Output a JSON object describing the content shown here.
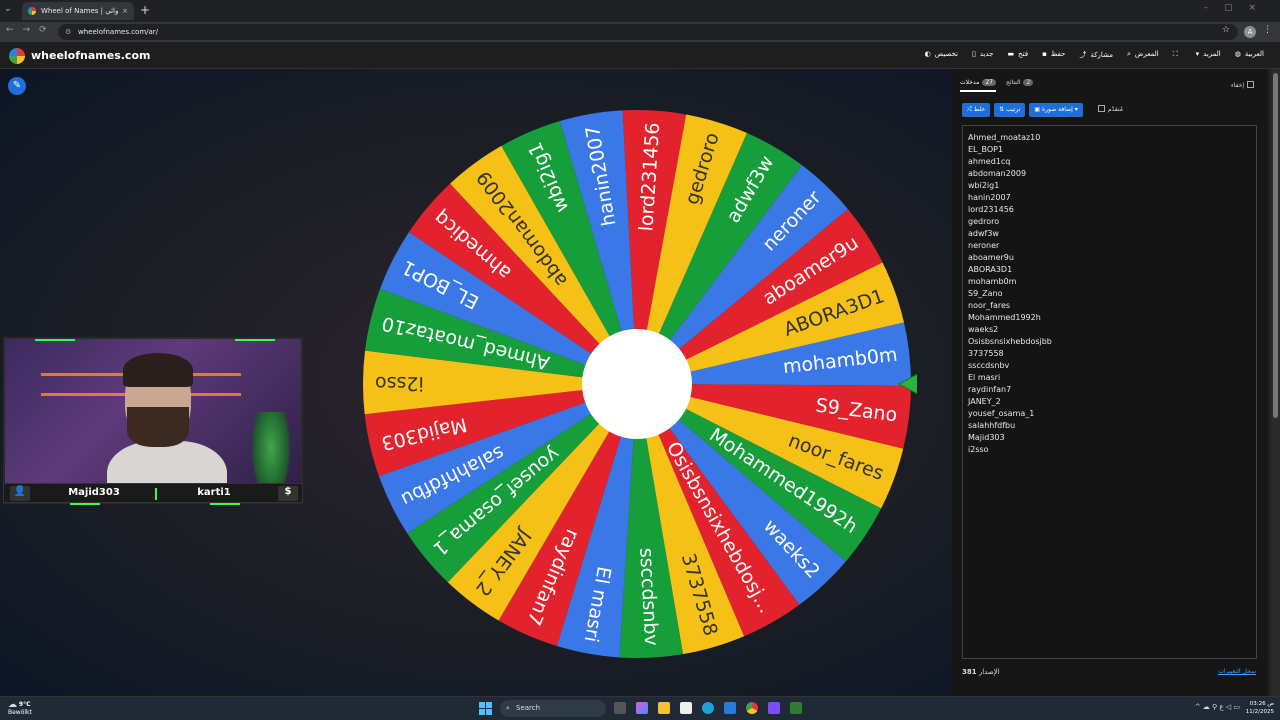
{
  "browser": {
    "tab_title": "Wheel of Names | سم العشوائي",
    "tab_close": "×",
    "tab_menu": "⌄",
    "new_tab": "+",
    "window_controls": "–▢×",
    "nav": "←→⟳",
    "url": "wheelofnames.com/ar/",
    "profile_initial": "A"
  },
  "header": {
    "site_name": "wheelofnames.com",
    "menu": [
      {
        "label": "العربية",
        "icon": "globe-icon"
      },
      {
        "label": "المزيد",
        "icon": "chevron-down-icon"
      },
      {
        "label": "",
        "icon": "fullscreen-icon"
      },
      {
        "label": "المعرض",
        "icon": "search-icon"
      },
      {
        "label": "مشاركة",
        "icon": "share-icon"
      },
      {
        "label": "حفظ",
        "icon": "save-icon"
      },
      {
        "label": "فتح",
        "icon": "folder-icon"
      },
      {
        "label": "جديد",
        "icon": "new-file-icon"
      },
      {
        "label": "تخصيص",
        "icon": "palette-icon"
      }
    ]
  },
  "wheel": {
    "segments": [
      "mohamb0m",
      "S9_Zano",
      "noor_fares",
      "Mohammed1992h",
      "waeks2",
      "Osisbsnsixhebdosj...",
      "3737558",
      "ssccdsnbv",
      "El masri",
      "raydinfan7",
      "JANEY_2",
      "yousef_osama_1",
      "salahhfdfbu",
      "Majid303",
      "i2sso",
      "Ahmed_moataz10",
      "EL_BOP1",
      "ahmedicq",
      "abdoman2009",
      "wbi2ig1",
      "hanin2007",
      "lord231456",
      "gedroro",
      "adwf3w",
      "neroner",
      "aboamer9u",
      "ABORA3D1"
    ],
    "colors": [
      "#3b78e7",
      "#e2232e",
      "#f5c116",
      "#169e3a"
    ]
  },
  "stream": {
    "left_name": "Majid303",
    "right_name": "karti1",
    "user_icon": "👤",
    "dollar_icon": "$"
  },
  "panel": {
    "tab_entries": "مدخلات",
    "entries_count": "27",
    "tab_results": "النتائج",
    "results_count": "2",
    "hide_label": "إخفاء",
    "shuffle_label": "خلط",
    "sort_label": "ترتيب",
    "add_image_label": "إضافة صورة",
    "advanced_label": "مُتقدّم",
    "entries": [
      "Ahmed_moataz10",
      "EL_BOP1",
      "ahmed1cq",
      "abdoman2009",
      "wbi2ig1",
      "hanin2007",
      "lord231456",
      "gedroro",
      "adwf3w",
      "neroner",
      "aboamer9u",
      "ABORA3D1",
      "mohamb0m",
      "S9_Zano",
      "noor_fares",
      "Mohammed1992h",
      "waeks2",
      "Osisbsnsixhebdosjbb",
      "3737558",
      "ssccdsnbv",
      "El masri",
      "raydinfan7",
      "JANEY_2",
      "yousef_osama_1",
      "salahhfdfbu",
      "Majid303",
      "i2sso"
    ],
    "version_label": "الإصدار",
    "version_number": "381",
    "changelog_label": "سجل التغييرات"
  },
  "taskbar": {
    "temp": "9°C",
    "weather_text": "Bewölkt",
    "search_placeholder": "Search",
    "time": "ص 03:26",
    "date": "11/2/2025"
  }
}
